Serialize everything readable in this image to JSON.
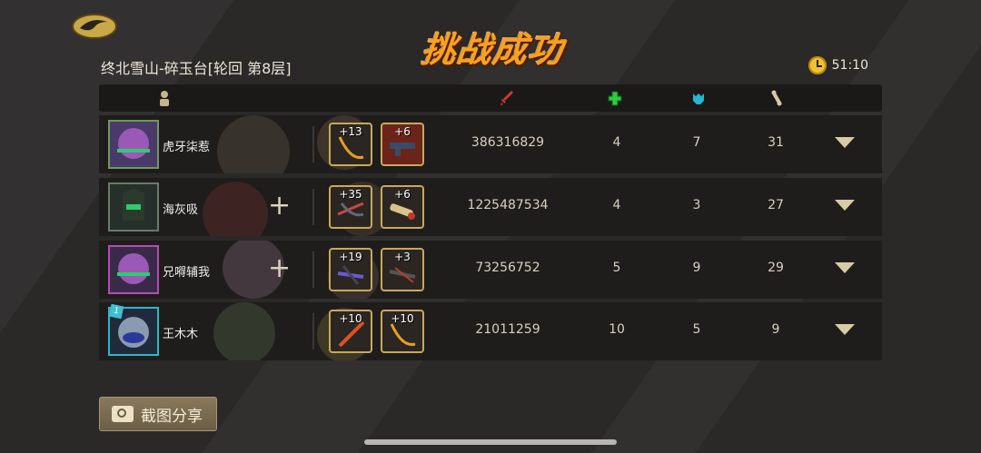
{
  "header": {
    "title": "挑战成功",
    "level": "终北雪山-碎玉台[轮回 第8层]",
    "timer": "51:10"
  },
  "columns": {
    "player_icon": "person-icon",
    "damage_icon": "sword-icon",
    "heal_icon": "green-cross-icon",
    "tank_icon": "wolf-icon",
    "bone_icon": "bone-icon"
  },
  "players": [
    {
      "name": "虎牙柒惹",
      "items": [
        {
          "level": "+13"
        },
        {
          "level": "+6"
        }
      ],
      "damage": "386316829",
      "heal": "4",
      "tank": "7",
      "bone": "31",
      "has_plus": false
    },
    {
      "name": "海灰吸",
      "items": [
        {
          "level": "+35"
        },
        {
          "level": "+6"
        }
      ],
      "damage": "1225487534",
      "heal": "4",
      "tank": "3",
      "bone": "27",
      "has_plus": true
    },
    {
      "name": "兄嘚辅我",
      "items": [
        {
          "level": "+19"
        },
        {
          "level": "+3"
        }
      ],
      "damage": "73256752",
      "heal": "5",
      "tank": "9",
      "bone": "29",
      "has_plus": true
    },
    {
      "name": "王木木",
      "items": [
        {
          "level": "+10"
        },
        {
          "level": "+10"
        }
      ],
      "damage": "21011259",
      "heal": "10",
      "tank": "5",
      "bone": "9",
      "has_plus": false
    }
  ],
  "footer": {
    "share_label": "截图分享"
  },
  "colors": {
    "accent": "#f7a21b",
    "row_bg": "#1e1d1c",
    "button": "#7a6b50"
  }
}
